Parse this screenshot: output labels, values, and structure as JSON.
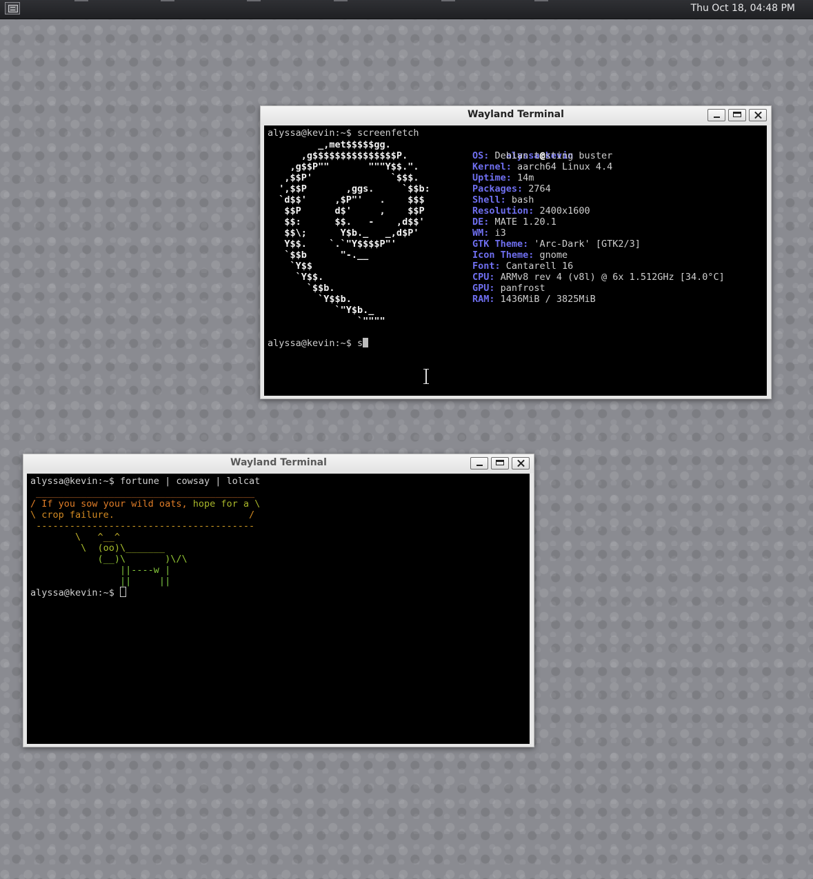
{
  "panel": {
    "clock": "Thu Oct 18, 04:48 PM",
    "menu_icon": "app-menu-icon"
  },
  "terminal_top": {
    "title": "Wayland Terminal",
    "command_line": "alyssa@kevin:~$ screenfetch",
    "logo_lines": [
      "         _,met$$$$$gg.",
      "      ,g$$$$$$$$$$$$$$$P.",
      "    ,g$$P\"\"       \"\"\"Y$$.\".",
      "   ,$$P'              `$$$.",
      "  ',$$P       ,ggs.     `$$b:",
      "  `d$$'     ,$P\"'   .    $$$",
      "   $$P      d$'     ,    $$P",
      "   $$:      $$.   -    ,d$$'",
      "   $$\\;      Y$b._   _,d$P'",
      "   Y$$.    `.`\"Y$$$$P\"'",
      "   `$$b      \"-.__",
      "    `Y$$",
      "     `Y$$.",
      "       `$$b.",
      "         `Y$$b.",
      "            `\"Y$b._",
      "                `\"\"\"\""
    ],
    "user": "alyssa",
    "at": "@",
    "host": "kevin",
    "info": [
      {
        "key": "OS:",
        "value": " Debian testing buster"
      },
      {
        "key": "Kernel:",
        "value": " aarch64 Linux 4.4"
      },
      {
        "key": "Uptime:",
        "value": " 14m"
      },
      {
        "key": "Packages:",
        "value": " 2764"
      },
      {
        "key": "Shell:",
        "value": " bash"
      },
      {
        "key": "Resolution:",
        "value": " 2400x1600"
      },
      {
        "key": "DE:",
        "value": " MATE 1.20.1"
      },
      {
        "key": "WM:",
        "value": " i3"
      },
      {
        "key": "GTK Theme:",
        "value": " 'Arc-Dark' [GTK2/3]"
      },
      {
        "key": "Icon Theme:",
        "value": " gnome"
      },
      {
        "key": "Font:",
        "value": " Cantarell 16"
      },
      {
        "key": "CPU:",
        "value": " ARMv8 rev 4 (v8l) @ 6x 1.512GHz [34.0°C]"
      },
      {
        "key": "GPU:",
        "value": " panfrost"
      },
      {
        "key": "RAM:",
        "value": " 1436MiB / 3825MiB"
      }
    ],
    "prompt": "alyssa@kevin:~$ s"
  },
  "terminal_bottom": {
    "title": "Wayland Terminal",
    "command_line": "alyssa@kevin:~$ fortune | cowsay | lolcat",
    "bubble_top": " _______________________________________",
    "bubble_line1_a": "/ If you sow your wild oats,",
    "bubble_line1_b": " hope for a \\",
    "bubble_line2": "\\ crop failure.                        /",
    "bubble_bottom": " ---------------------------------------",
    "cow": [
      "        \\   ^__^",
      "         \\  (oo)\\_______",
      "            (__)\\       )\\/\\",
      "                ||----w |",
      "                ||     ||"
    ],
    "prompt": "alyssa@kevin:~$ "
  },
  "colors": {
    "desktop": "#8a8b91",
    "panel": "#26272a",
    "terminal_bg": "#000000",
    "accent_blue": "#6f6ff0",
    "lolcat_orange": "#d98a2a",
    "lolcat_green": "#8cc83a"
  }
}
